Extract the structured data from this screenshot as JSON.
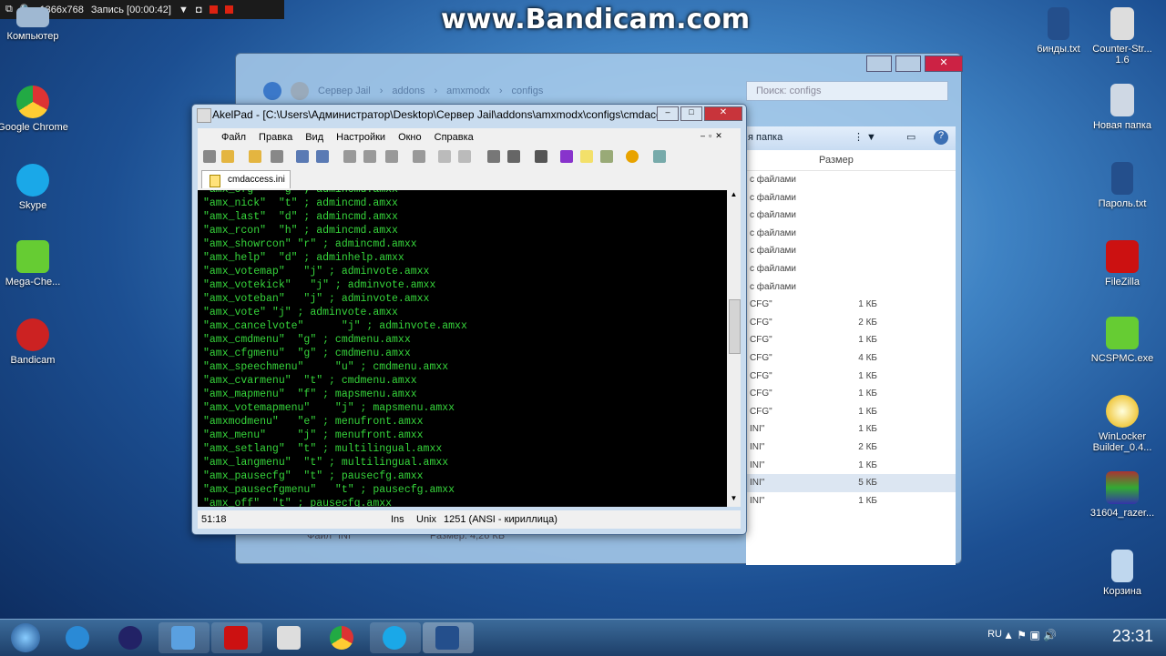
{
  "recorder": {
    "resolution": "1366x768",
    "status": "Запись [00:00:42]"
  },
  "watermark": "www.Bandicam.com",
  "desktop_left": [
    {
      "label": "Компьютер",
      "icon": "computer-icon"
    },
    {
      "label": "Google Chrome",
      "icon": "chrome-icon"
    },
    {
      "label": "Skype",
      "icon": "skype-icon"
    },
    {
      "label": "Mega-Che...",
      "icon": "mega-cheat-icon"
    },
    {
      "label": "Bandicam",
      "icon": "bandicam-icon"
    }
  ],
  "desktop_right": [
    {
      "label": "6инды.txt",
      "icon": "text-file-icon"
    },
    {
      "label": "Counter-Str... 1.6",
      "icon": "counter-strike-icon"
    },
    {
      "label": "Новая папка",
      "icon": "folder-icon"
    },
    {
      "label": "Пароль.txt",
      "icon": "text-file-icon"
    },
    {
      "label": "FileZilla",
      "icon": "filezilla-icon"
    },
    {
      "label": "NCSPMC.exe",
      "icon": "exe-icon"
    },
    {
      "label": "WinLocker Builder_0.4...",
      "icon": "winlocker-icon"
    },
    {
      "label": "31604_razer...",
      "icon": "archive-icon"
    },
    {
      "label": "Корзина",
      "icon": "recycle-bin-icon"
    }
  ],
  "explorer": {
    "breadcrumb": [
      "Сервер Jail",
      "addons",
      "amxmodx",
      "configs"
    ],
    "search_placeholder": "Поиск: configs",
    "toolbar_label": "я папка",
    "column_size": "Размер",
    "rows": [
      {
        "type": "с файлами",
        "size": ""
      },
      {
        "type": "с файлами",
        "size": ""
      },
      {
        "type": "с файлами",
        "size": ""
      },
      {
        "type": "с файлами",
        "size": ""
      },
      {
        "type": "с файлами",
        "size": ""
      },
      {
        "type": "с файлами",
        "size": ""
      },
      {
        "type": "с файлами",
        "size": ""
      },
      {
        "type": "CFG\"",
        "size": "1 КБ"
      },
      {
        "type": "CFG\"",
        "size": "2 КБ"
      },
      {
        "type": "CFG\"",
        "size": "1 КБ"
      },
      {
        "type": "CFG\"",
        "size": "4 КБ"
      },
      {
        "type": "CFG\"",
        "size": "1 КБ"
      },
      {
        "type": "CFG\"",
        "size": "1 КБ"
      },
      {
        "type": "CFG\"",
        "size": "1 КБ"
      },
      {
        "type": "INI\"",
        "size": "1 КБ"
      },
      {
        "type": "INI\"",
        "size": "2 КБ"
      },
      {
        "type": "INI\"",
        "size": "1 КБ"
      },
      {
        "type": "INI\"",
        "size": "5 КБ"
      },
      {
        "type": "INI\"",
        "size": "1 КБ"
      }
    ],
    "status_type": "Файл \"INI\"",
    "status_size": "Размер: 4,26 КБ"
  },
  "akelpad": {
    "title": "AkelPad - [C:\\Users\\Администратор\\Desktop\\Сервер Jail\\addons\\amxmodx\\configs\\cmdacce...",
    "menu": [
      "Файл",
      "Правка",
      "Вид",
      "Настройки",
      "Окно",
      "Справка"
    ],
    "tab": "cmdaccess.ini",
    "lines": [
      "\"amx_cfg\"   \"g\" ; admincmd.amxx",
      "\"amx_nick\"  \"t\" ; admincmd.amxx",
      "\"amx_last\"  \"d\" ; admincmd.amxx",
      "\"amx_rcon\"  \"h\" ; admincmd.amxx",
      "\"amx_showrcon\" \"r\" ; admincmd.amxx",
      "\"amx_help\"  \"d\" ; adminhelp.amxx",
      "\"amx_votemap\"   \"j\" ; adminvote.amxx",
      "\"amx_votekick\"   \"j\" ; adminvote.amxx",
      "\"amx_voteban\"   \"j\" ; adminvote.amxx",
      "\"amx_vote\" \"j\" ; adminvote.amxx",
      "\"amx_cancelvote\"      \"j\" ; adminvote.amxx",
      "\"amx_cmdmenu\"  \"g\" ; cmdmenu.amxx",
      "\"amx_cfgmenu\"  \"g\" ; cmdmenu.amxx",
      "\"amx_speechmenu\"     \"u\" ; cmdmenu.amxx",
      "\"amx_cvarmenu\"  \"t\" ; cmdmenu.amxx",
      "\"amx_mapmenu\"  \"f\" ; mapsmenu.amxx",
      "\"amx_votemapmenu\"    \"j\" ; mapsmenu.amxx",
      "\"amxmodmenu\"   \"e\" ; menufront.amxx",
      "\"amx_menu\"     \"j\" ; menufront.amxx",
      "\"amx_setlang\"  \"t\" ; multilingual.amxx",
      "\"amx_langmenu\"  \"t\" ; multilingual.amxx",
      "\"amx_pausecfg\"  \"t\" ; pausecfg.amxx",
      "\"amx_pausecfgmenu\"   \"t\" ; pausecfg.amxx",
      "\"amx_off\"  \"t\" ; pausecfg.amxx"
    ],
    "status": {
      "position": "51:18",
      "mode": "Ins",
      "newline": "Unix",
      "codepage": "1251  (ANSI - кириллица)"
    }
  },
  "taskbar": {
    "apps": [
      "start-orb-icon",
      "internet-explorer-icon",
      "media-player-icon",
      "explorer-icon",
      "filezilla-icon",
      "counter-strike-icon",
      "chrome-icon",
      "skype-icon",
      "akelpad-icon"
    ],
    "lang": "RU",
    "time": "23:31"
  }
}
